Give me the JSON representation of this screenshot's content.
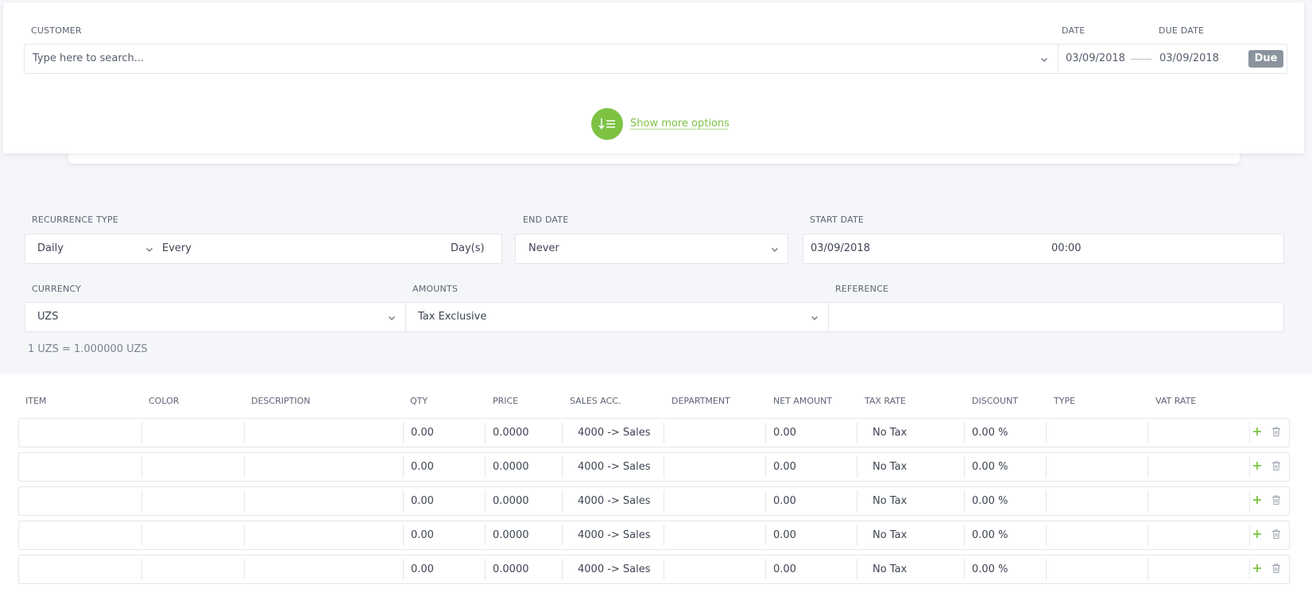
{
  "header": {
    "customer_label": "CUSTOMER",
    "customer_placeholder": "Type here to search...",
    "date_label": "DATE",
    "due_date_label": "DUE DATE",
    "date_value": "03/09/2018",
    "due_date_value": "03/09/2018",
    "due_button": "Due",
    "show_more": "Show more options"
  },
  "recurrence": {
    "type_label": "RECURRENCE TYPE",
    "type_value": "Daily",
    "every_label": "Every",
    "unit_label": "Day(s)",
    "end_date_label": "END DATE",
    "end_date_value": "Never",
    "start_date_label": "START DATE",
    "start_date_value": "03/09/2018",
    "start_time_value": "00:00"
  },
  "currency": {
    "currency_label": "CURRENCY",
    "currency_value": "UZS",
    "amounts_label": "AMOUNTS",
    "amounts_value": "Tax Exclusive",
    "reference_label": "REFERENCE",
    "reference_value": "",
    "rate_text": "1 UZS = 1.000000 UZS"
  },
  "table": {
    "headers": {
      "item": "ITEM",
      "color": "COLOR",
      "description": "DESCRIPTION",
      "qty": "QTY",
      "price": "PRICE",
      "sales_acc": "SALES ACC.",
      "department": "DEPARTMENT",
      "net_amount": "NET AMOUNT",
      "tax_rate": "TAX RATE",
      "discount": "DISCOUNT",
      "type": "TYPE",
      "vat_rate": "VAT RATE"
    },
    "rows": [
      {
        "qty": "0.00",
        "price": "0.0000",
        "sales_acc": "4000 -> Sales",
        "net_amount": "0.00",
        "tax_rate": "No Tax",
        "discount": "0.00 %"
      },
      {
        "qty": "0.00",
        "price": "0.0000",
        "sales_acc": "4000 -> Sales",
        "net_amount": "0.00",
        "tax_rate": "No Tax",
        "discount": "0.00 %"
      },
      {
        "qty": "0.00",
        "price": "0.0000",
        "sales_acc": "4000 -> Sales",
        "net_amount": "0.00",
        "tax_rate": "No Tax",
        "discount": "0.00 %"
      },
      {
        "qty": "0.00",
        "price": "0.0000",
        "sales_acc": "4000 -> Sales",
        "net_amount": "0.00",
        "tax_rate": "No Tax",
        "discount": "0.00 %"
      },
      {
        "qty": "0.00",
        "price": "0.0000",
        "sales_acc": "4000 -> Sales",
        "net_amount": "0.00",
        "tax_rate": "No Tax",
        "discount": "0.00 %"
      }
    ]
  },
  "icons": {
    "chevron": "chevron-down-icon",
    "options": "sort-list-icon",
    "add_row": "plus-icon",
    "delete_row": "trash-icon"
  },
  "colors": {
    "accent_green": "#7dc243",
    "due_button_bg": "#8b939e",
    "page_bg": "#f4f6f9"
  }
}
